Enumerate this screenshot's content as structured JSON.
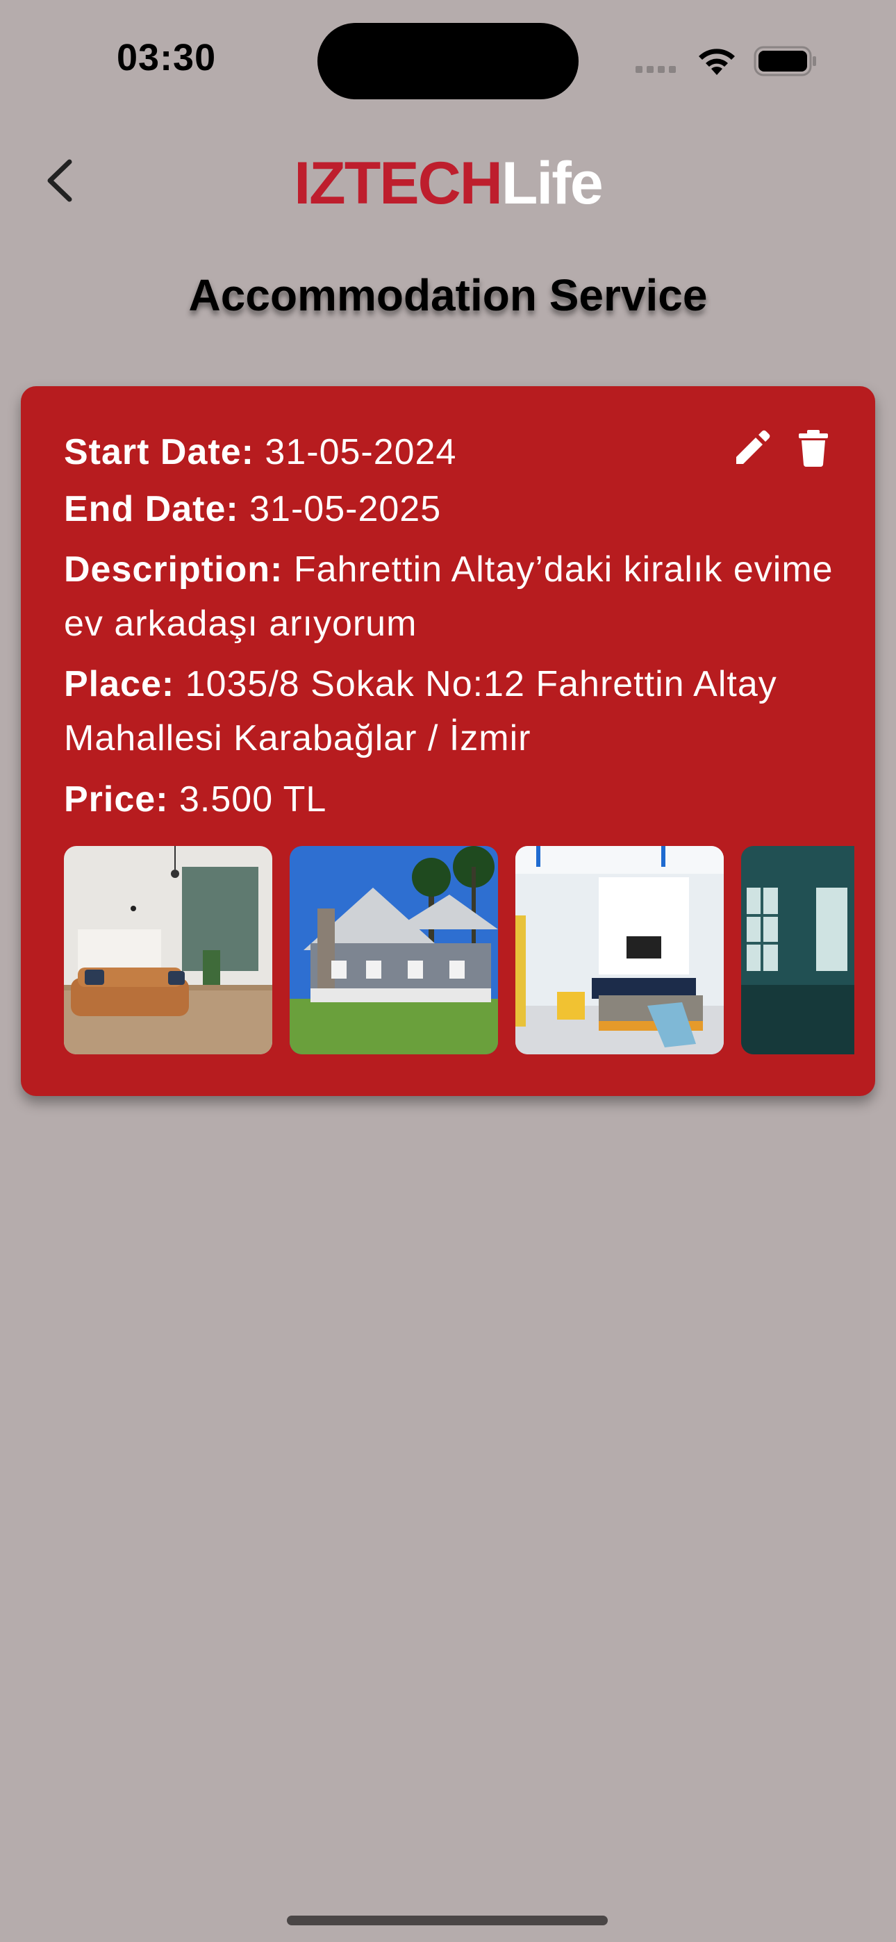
{
  "status": {
    "time": "03:30"
  },
  "header": {
    "logo_part1": "IZTECH",
    "logo_part2": "Life",
    "title": "Accommodation Service"
  },
  "listing": {
    "start_label": "Start Date:",
    "start_value": "31-05-2024",
    "end_label": "End Date:",
    "end_value": "31-05-2025",
    "description_label": "Description:",
    "description_value": "Fahrettin Altay’daki kiralık evime ev arkadaşı arıyorum",
    "place_label": "Place:",
    "place_value": "1035/8 Sokak No:12 Fahrettin Altay Mahallesi Karabağlar / İzmir",
    "price_label": "Price:",
    "price_value": "3.500 TL"
  },
  "colors": {
    "background": "#b5acac",
    "card": "#b71c1f",
    "brand_red": "#be1e2d"
  },
  "icons": [
    "back-chevron-icon",
    "edit-pencil-icon",
    "trash-icon",
    "wifi-icon",
    "battery-icon"
  ]
}
